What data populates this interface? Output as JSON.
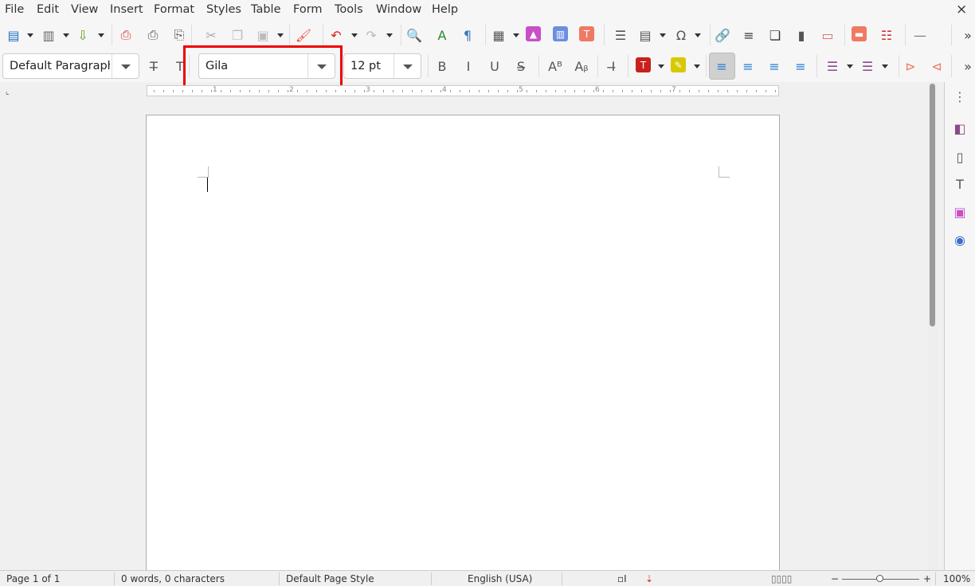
{
  "menubar": {
    "items": [
      "File",
      "Edit",
      "View",
      "Insert",
      "Format",
      "Styles",
      "Table",
      "Form",
      "Tools",
      "Window",
      "Help"
    ],
    "close_icon": "×"
  },
  "toolbar_standard": [
    "new-document",
    "templates",
    "save",
    "export-pdf",
    "print",
    "print-preview",
    "cut",
    "copy",
    "paste",
    "clone-formatting",
    "undo",
    "redo",
    "find-replace",
    "spelling",
    "formatting-marks",
    "insert-table",
    "insert-image",
    "insert-chart",
    "insert-text-box",
    "page-break",
    "insert-field",
    "special-character",
    "hyperlink",
    "footnote",
    "endnote",
    "bookmark",
    "cross-reference",
    "comment",
    "track-changes",
    "horizontal-line",
    "more"
  ],
  "formatting": {
    "paragraph_style": "Default Paragraph Style",
    "font_name": "Gila",
    "font_size": "12 pt",
    "active_alignment": "left"
  },
  "ruler": {
    "labels": [
      "1",
      "2",
      "3",
      "4",
      "5",
      "6",
      "7"
    ]
  },
  "status": {
    "page": "Page 1 of 1",
    "words": "0 words, 0 characters",
    "page_style": "Default Page Style",
    "language": "English (USA)",
    "zoom": "100%",
    "zoom_level": 100
  },
  "colors": {
    "highlight_box": "#ee0000",
    "accent": "#1e7bd2",
    "font_color": "#c9211e",
    "highlight_color": "#ffff00"
  }
}
